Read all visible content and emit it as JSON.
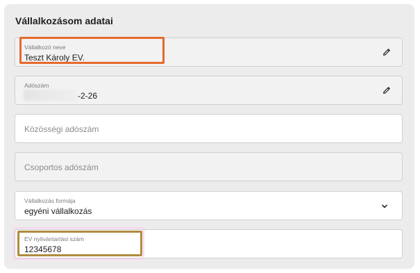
{
  "card": {
    "title": "Vállalkozásom adatai"
  },
  "fields": {
    "business_name": {
      "label": "Vállalkozó neve",
      "value": "Teszt Károly EV."
    },
    "tax_number": {
      "label": "Adószám",
      "value_visible": "-2-26"
    },
    "community_tax_number": {
      "placeholder": "Közösségi adószám"
    },
    "group_tax_number": {
      "placeholder": "Csoportos adószám"
    },
    "business_form": {
      "label": "Vállalkozás formája",
      "value": "egyéni vállalkozás"
    },
    "ev_registration": {
      "label": "EV nyilvántartási szám",
      "value": "12345678"
    }
  },
  "icons": {
    "edit": "pencil-icon",
    "dropdown": "chevron-down-icon"
  },
  "colors": {
    "highlight_orange": "#e66a2c",
    "highlight_olive": "#b08a3e",
    "card_bg": "#ececec"
  }
}
